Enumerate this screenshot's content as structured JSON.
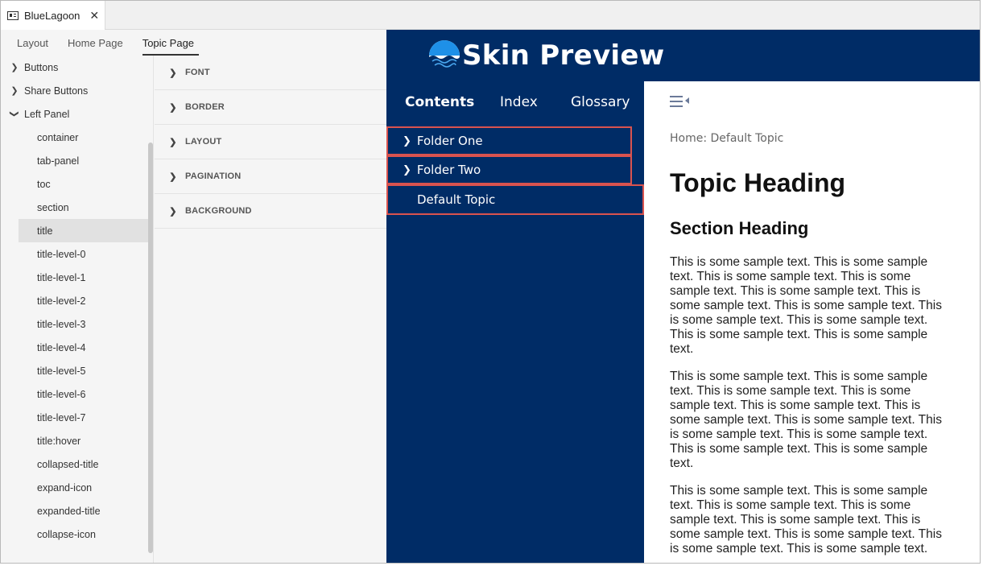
{
  "document_tab": {
    "title": "BlueLagoon",
    "close": "✕"
  },
  "sub_tabs": [
    "Layout",
    "Home Page",
    "Topic Page"
  ],
  "tree": {
    "parents": [
      "Buttons",
      "Share Buttons",
      "Left Panel"
    ],
    "children": [
      "container",
      "tab-panel",
      "toc",
      "section",
      "title",
      "title-level-0",
      "title-level-1",
      "title-level-2",
      "title-level-3",
      "title-level-4",
      "title-level-5",
      "title-level-6",
      "title-level-7",
      "title:hover",
      "collapsed-title",
      "expand-icon",
      "expanded-title",
      "collapse-icon"
    ],
    "selected": "title"
  },
  "property_groups": [
    "FONT",
    "BORDER",
    "LAYOUT",
    "PAGINATION",
    "BACKGROUND"
  ],
  "preview": {
    "title": "Skin Preview",
    "tabs": [
      "Contents",
      "Index",
      "Glossary"
    ],
    "toc_items": [
      "Folder One",
      "Folder Two",
      "Default Topic"
    ],
    "breadcrumb": "Home: Default Topic",
    "topic_heading": "Topic Heading",
    "section_heading": "Section Heading",
    "paragraphs": [
      "This is some sample text. This is some sample text. This is some sample text. This is some sample text. This is some sample text. This is some sample text. This is some sample text. This is some sample text. This is some sample text. This is some sample text. This is some sample text.",
      "This is some sample text. This is some sample text. This is some sample text. This is some sample text. This is some sample text. This is some sample text. This is some sample text. This is some sample text. This is some sample text. This is some sample text. This is some sample text.",
      "This is some sample text. This is some sample text. This is some sample text. This is some sample text. This is some sample text. This is some sample text. This is some sample text. This is some sample text. This is some sample text."
    ],
    "colors": {
      "header_bg": "#002c66",
      "highlight_border": "#d9534f"
    }
  }
}
